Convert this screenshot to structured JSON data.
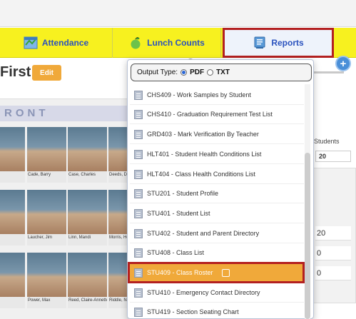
{
  "nav": {
    "attendance_label": "Attendance",
    "lunch_label": "Lunch Counts",
    "reports_label": "Reports"
  },
  "header": {
    "title": "First",
    "edit_label": "Edit"
  },
  "roster": {
    "section_label": "RONT",
    "photos": [
      {
        "caption": "s"
      },
      {
        "caption": "Cade, Barry"
      },
      {
        "caption": "Case, Charles"
      },
      {
        "caption": "Deeds, D"
      },
      {
        "caption": ""
      },
      {
        "caption": "Laucher, Jim"
      },
      {
        "caption": "Linn, Mandi"
      },
      {
        "caption": "Morris, He"
      },
      {
        "caption": ""
      },
      {
        "caption": "Power, Max"
      },
      {
        "caption": "Reed, Claire-Annette"
      },
      {
        "caption": "Riddle, Ne"
      }
    ]
  },
  "summary": {
    "students_header": "Students",
    "students_value": "20",
    "values": [
      "20",
      "0",
      "0"
    ]
  },
  "report_menu": {
    "output_type_label": "Output Type:",
    "pdf_label": "PDF",
    "txt_label": "TXT",
    "selected_output": "PDF",
    "items": [
      {
        "label": "CHS409 - Work Samples by Student"
      },
      {
        "label": "CHS410 - Graduation Requirement Test List"
      },
      {
        "label": "GRD403 - Mark Verification By Teacher"
      },
      {
        "label": "HLT401 - Student Health Conditions List"
      },
      {
        "label": "HLT404 - Class Health Conditions List"
      },
      {
        "label": "STU201 - Student Profile"
      },
      {
        "label": "STU401 - Student List"
      },
      {
        "label": "STU402 - Student and Parent Directory"
      },
      {
        "label": "STU408 - Class List"
      },
      {
        "label": "STU409 - Class Roster"
      },
      {
        "label": "STU410 - Emergency Contact Directory"
      },
      {
        "label": "STU419 - Section Seating Chart"
      }
    ],
    "selected_item": "STU409 - Class Roster"
  },
  "colors": {
    "nav_bg": "#f7f11f",
    "nav_text": "#2a52be",
    "highlight": "#f0a93a",
    "callout_border": "#b32020"
  }
}
